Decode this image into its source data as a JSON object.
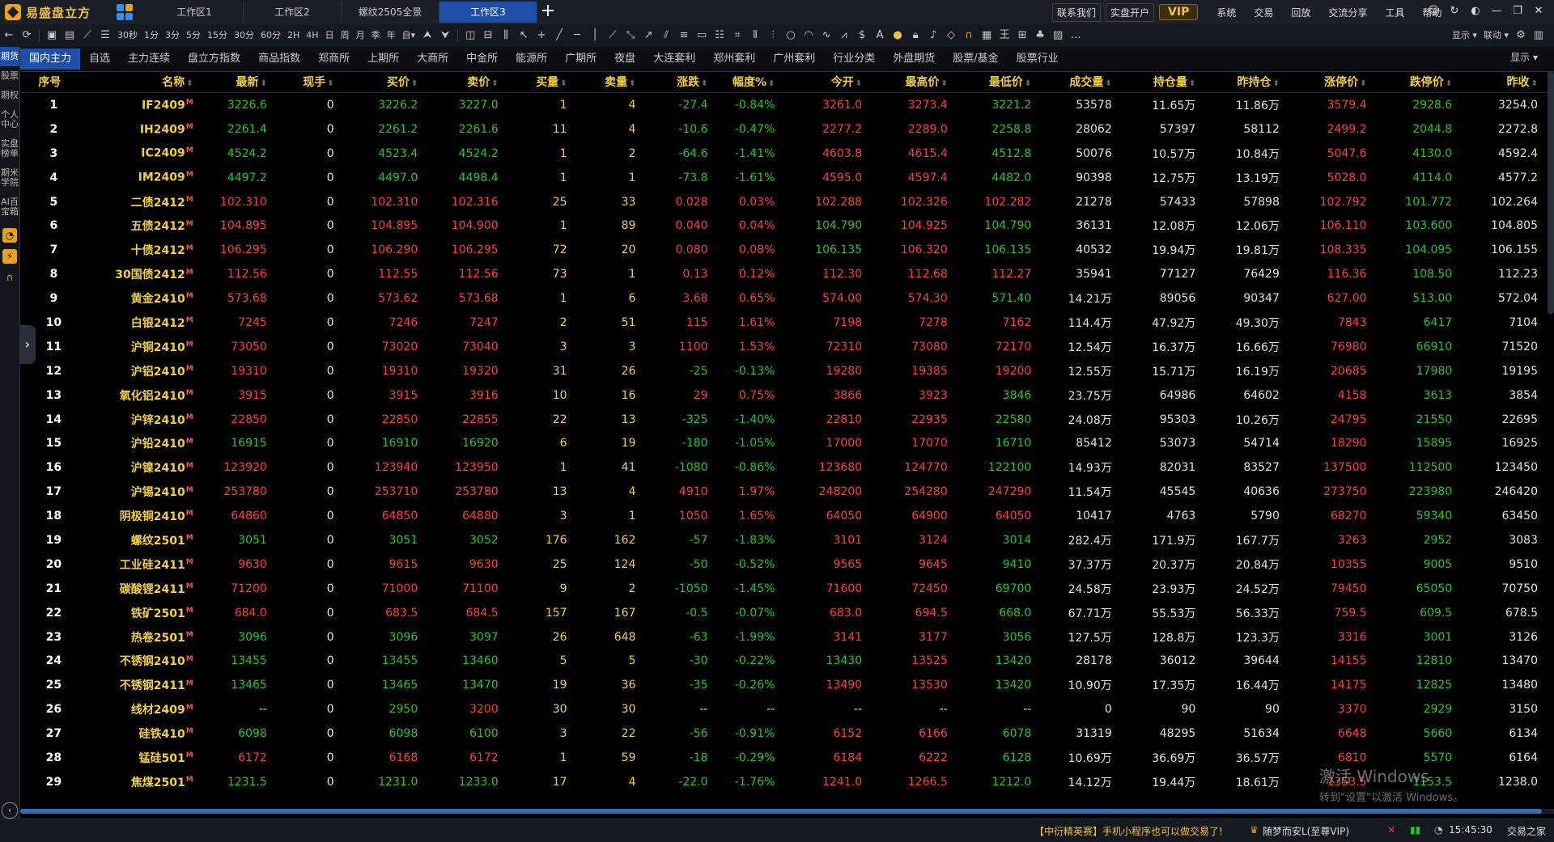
{
  "app": {
    "name": "易盛盘立方"
  },
  "workspace_tabs": [
    "工作区1",
    "工作区2",
    "螺纹2505全景",
    "工作区3"
  ],
  "active_workspace": 3,
  "title_buttons": [
    "联系我们",
    "实盘开户"
  ],
  "vip": "VIP",
  "menu": [
    "系统",
    "交易",
    "回放",
    "交流分享",
    "工具",
    "帮助"
  ],
  "toolbar": {
    "periods": [
      "30秒",
      "1分",
      "3分",
      "5分",
      "15分",
      "30分",
      "60分",
      "2H",
      "4H",
      "日",
      "周",
      "月",
      "季",
      "年"
    ],
    "custom": "自▾",
    "display": "显示 ▾",
    "link": "联动 ▾"
  },
  "leftnav": {
    "items": [
      "期货",
      "股票",
      "期权",
      "个人中心",
      "实盘榜单",
      "期米学院",
      "AI百宝箱"
    ],
    "active": 0,
    "icons": [
      "clock-icon",
      "lightning-icon",
      "headset-icon"
    ]
  },
  "category_tabs": [
    "国内主力",
    "自选",
    "主力连续",
    "盘立方指数",
    "商品指数",
    "郑商所",
    "上期所",
    "大商所",
    "中金所",
    "能源所",
    "广期所",
    "夜盘",
    "大连套利",
    "郑州套利",
    "广州套利",
    "行业分类",
    "外盘期货",
    "股票/基金",
    "股票行业"
  ],
  "active_category": 0,
  "category_right": "显示 ▾",
  "columns": [
    "序号",
    "名称",
    "最新",
    "现手",
    "买价",
    "卖价",
    "买量",
    "卖量",
    "涨跌",
    "幅度%",
    "今开",
    "最高价",
    "最低价",
    "成交量",
    "持仓量",
    "昨持仓",
    "涨停价",
    "跌停价",
    "昨收"
  ],
  "sort_glyph": "⬍",
  "main_flag": "M",
  "rows": [
    [
      "1",
      "IF2409",
      "3226.6",
      "0",
      "3226.2",
      "3227.0",
      "1",
      "4",
      "-27.4",
      "-0.84%",
      "3261.0",
      "3273.4",
      "3221.2",
      "53578",
      "11.65万",
      "11.86万",
      "3579.4",
      "2928.6",
      "3254.0"
    ],
    [
      "2",
      "IH2409",
      "2261.4",
      "0",
      "2261.2",
      "2261.6",
      "11",
      "4",
      "-10.6",
      "-0.47%",
      "2277.2",
      "2289.0",
      "2258.8",
      "28062",
      "57397",
      "58112",
      "2499.2",
      "2044.8",
      "2272.8"
    ],
    [
      "3",
      "IC2409",
      "4524.2",
      "0",
      "4523.4",
      "4524.2",
      "1",
      "2",
      "-64.6",
      "-1.41%",
      "4603.8",
      "4615.4",
      "4512.8",
      "50076",
      "10.57万",
      "10.84万",
      "5047.6",
      "4130.0",
      "4592.4"
    ],
    [
      "4",
      "IM2409",
      "4497.2",
      "0",
      "4497.0",
      "4498.4",
      "1",
      "1",
      "-73.8",
      "-1.61%",
      "4595.0",
      "4597.4",
      "4482.0",
      "90398",
      "12.75万",
      "13.19万",
      "5028.0",
      "4114.0",
      "4577.2"
    ],
    [
      "5",
      "二债2412",
      "102.310",
      "0",
      "102.310",
      "102.316",
      "25",
      "33",
      "0.028",
      "0.03%",
      "102.288",
      "102.326",
      "102.282",
      "21278",
      "57433",
      "57898",
      "102.792",
      "101.772",
      "102.264"
    ],
    [
      "6",
      "五债2412",
      "104.895",
      "0",
      "104.895",
      "104.900",
      "1",
      "89",
      "0.040",
      "0.04%",
      "104.790",
      "104.925",
      "104.790",
      "36131",
      "12.08万",
      "12.06万",
      "106.110",
      "103.600",
      "104.805"
    ],
    [
      "7",
      "十债2412",
      "106.295",
      "0",
      "106.290",
      "106.295",
      "72",
      "20",
      "0.080",
      "0.08%",
      "106.135",
      "106.320",
      "106.135",
      "40532",
      "19.94万",
      "19.81万",
      "108.335",
      "104.095",
      "106.155"
    ],
    [
      "8",
      "30国债2412",
      "112.56",
      "0",
      "112.55",
      "112.56",
      "73",
      "1",
      "0.13",
      "0.12%",
      "112.30",
      "112.68",
      "112.27",
      "35941",
      "77127",
      "76429",
      "116.36",
      "108.50",
      "112.23"
    ],
    [
      "9",
      "黄金2410",
      "573.68",
      "0",
      "573.62",
      "573.68",
      "1",
      "6",
      "3.68",
      "0.65%",
      "574.00",
      "574.30",
      "571.40",
      "14.21万",
      "89056",
      "90347",
      "627.00",
      "513.00",
      "572.04"
    ],
    [
      "10",
      "白银2412",
      "7245",
      "0",
      "7246",
      "7247",
      "2",
      "51",
      "115",
      "1.61%",
      "7198",
      "7278",
      "7162",
      "114.4万",
      "47.92万",
      "49.30万",
      "7843",
      "6417",
      "7104"
    ],
    [
      "11",
      "沪铜2410",
      "73050",
      "0",
      "73020",
      "73040",
      "3",
      "3",
      "1100",
      "1.53%",
      "72310",
      "73080",
      "72170",
      "12.54万",
      "16.37万",
      "16.66万",
      "76980",
      "66910",
      "71520"
    ],
    [
      "12",
      "沪铝2410",
      "19310",
      "0",
      "19310",
      "19320",
      "31",
      "26",
      "-25",
      "-0.13%",
      "19280",
      "19385",
      "19200",
      "12.55万",
      "15.71万",
      "16.19万",
      "20685",
      "17980",
      "19195"
    ],
    [
      "13",
      "氧化铝2410",
      "3915",
      "0",
      "3915",
      "3916",
      "10",
      "16",
      "29",
      "0.75%",
      "3866",
      "3923",
      "3846",
      "23.75万",
      "64986",
      "64602",
      "4158",
      "3613",
      "3854"
    ],
    [
      "14",
      "沪锌2410",
      "22850",
      "0",
      "22850",
      "22855",
      "22",
      "13",
      "-325",
      "-1.40%",
      "22810",
      "22935",
      "22580",
      "24.08万",
      "95303",
      "10.26万",
      "24795",
      "21550",
      "22695"
    ],
    [
      "15",
      "沪铅2410",
      "16915",
      "0",
      "16910",
      "16920",
      "6",
      "19",
      "-180",
      "-1.05%",
      "17000",
      "17070",
      "16710",
      "85412",
      "53073",
      "54714",
      "18290",
      "15895",
      "16925"
    ],
    [
      "16",
      "沪镍2410",
      "123920",
      "0",
      "123940",
      "123950",
      "1",
      "41",
      "-1080",
      "-0.86%",
      "123680",
      "124770",
      "122100",
      "14.93万",
      "82031",
      "83527",
      "137500",
      "112500",
      "123450"
    ],
    [
      "17",
      "沪锡2410",
      "253780",
      "0",
      "253710",
      "253780",
      "13",
      "4",
      "4910",
      "1.97%",
      "248200",
      "254280",
      "247290",
      "11.54万",
      "45545",
      "40636",
      "273750",
      "223980",
      "246420"
    ],
    [
      "18",
      "阴极铜2410",
      "64860",
      "0",
      "64850",
      "64880",
      "3",
      "1",
      "1050",
      "1.65%",
      "64050",
      "64900",
      "64050",
      "10417",
      "4763",
      "5790",
      "68270",
      "59340",
      "63450"
    ],
    [
      "19",
      "螺纹2501",
      "3051",
      "0",
      "3051",
      "3052",
      "176",
      "162",
      "-57",
      "-1.83%",
      "3101",
      "3124",
      "3014",
      "282.4万",
      "171.9万",
      "167.7万",
      "3263",
      "2952",
      "3083"
    ],
    [
      "20",
      "工业硅2411",
      "9630",
      "0",
      "9615",
      "9630",
      "25",
      "124",
      "-50",
      "-0.52%",
      "9565",
      "9645",
      "9410",
      "37.37万",
      "20.37万",
      "20.84万",
      "10355",
      "9005",
      "9510"
    ],
    [
      "21",
      "碳酸锂2411",
      "71200",
      "0",
      "71000",
      "71100",
      "9",
      "2",
      "-1050",
      "-1.45%",
      "71600",
      "72450",
      "69700",
      "24.58万",
      "23.93万",
      "24.52万",
      "79450",
      "65050",
      "70750"
    ],
    [
      "22",
      "铁矿2501",
      "684.0",
      "0",
      "683.5",
      "684.5",
      "157",
      "167",
      "-0.5",
      "-0.07%",
      "683.0",
      "694.5",
      "668.0",
      "67.71万",
      "55.53万",
      "56.33万",
      "759.5",
      "609.5",
      "678.5"
    ],
    [
      "23",
      "热卷2501",
      "3096",
      "0",
      "3096",
      "3097",
      "26",
      "648",
      "-63",
      "-1.99%",
      "3141",
      "3177",
      "3056",
      "127.5万",
      "128.8万",
      "123.3万",
      "3316",
      "3001",
      "3126"
    ],
    [
      "24",
      "不锈钢2410",
      "13455",
      "0",
      "13455",
      "13460",
      "5",
      "5",
      "-30",
      "-0.22%",
      "13430",
      "13525",
      "13420",
      "28178",
      "36012",
      "39644",
      "14155",
      "12810",
      "13470"
    ],
    [
      "25",
      "不锈钢2411",
      "13465",
      "0",
      "13465",
      "13470",
      "19",
      "36",
      "-35",
      "-0.26%",
      "13490",
      "13530",
      "13420",
      "10.90万",
      "17.35万",
      "16.44万",
      "14175",
      "12825",
      "13480"
    ],
    [
      "26",
      "线材2409",
      "--",
      "0",
      "2950",
      "3200",
      "30",
      "30",
      "--",
      "--",
      "--",
      "--",
      "--",
      "0",
      "90",
      "90",
      "3370",
      "2929",
      "3150"
    ],
    [
      "27",
      "硅铁410",
      "6098",
      "0",
      "6098",
      "6100",
      "3",
      "22",
      "-56",
      "-0.91%",
      "6152",
      "6166",
      "6078",
      "31319",
      "48295",
      "51634",
      "6648",
      "5660",
      "6134"
    ],
    [
      "28",
      "锰硅501",
      "6172",
      "0",
      "6168",
      "6172",
      "1",
      "59",
      "-18",
      "-0.29%",
      "6184",
      "6222",
      "6128",
      "10.69万",
      "36.69万",
      "36.57万",
      "6810",
      "5570",
      "6164"
    ],
    [
      "29",
      "焦煤2501",
      "1231.5",
      "0",
      "1231.0",
      "1233.0",
      "17",
      "4",
      "-22.0",
      "-1.76%",
      "1241.0",
      "1266.5",
      "1212.0",
      "14.12万",
      "19.44万",
      "18.61万",
      "1353.5",
      "1153.5",
      "1238.0"
    ]
  ],
  "status": {
    "ticker": "【中衍精英赛】手机小程序也可以做交易了!",
    "user": "随梦而安L(至尊VIP)",
    "time": "15:45:30",
    "brand": "交易之家"
  },
  "watermark": {
    "line1": "激活 Windows",
    "line2": "转到\"设置\"以激活 Windows。"
  },
  "colors": {
    "up": "#ff3b3b",
    "down": "#1ec81e",
    "header": "#f0d040",
    "accent": "#1e4fa8"
  }
}
